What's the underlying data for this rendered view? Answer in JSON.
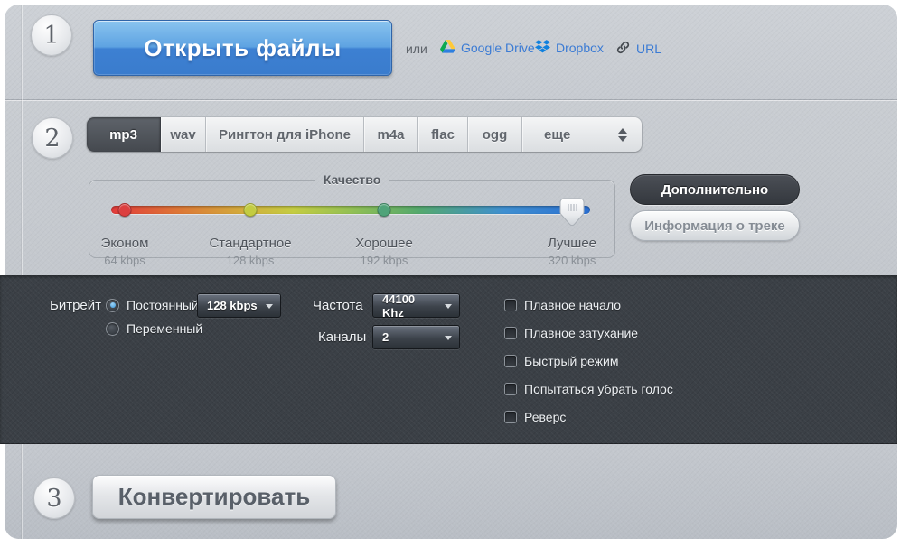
{
  "steps": {
    "one": "1",
    "two": "2",
    "three": "3"
  },
  "step1": {
    "open_button": "Открыть файлы",
    "or_text": "или",
    "links": [
      {
        "label": "Google Drive",
        "icon": "google-drive-icon"
      },
      {
        "label": "Dropbox",
        "icon": "dropbox-icon"
      },
      {
        "label": "URL",
        "icon": "link-icon"
      }
    ]
  },
  "step2": {
    "tabs": [
      {
        "label": "mp3",
        "active": true
      },
      {
        "label": "wav",
        "active": false
      },
      {
        "label": "Рингтон для iPhone",
        "active": false
      },
      {
        "label": "m4a",
        "active": false
      },
      {
        "label": "flac",
        "active": false
      },
      {
        "label": "ogg",
        "active": false
      },
      {
        "label": "еще",
        "active": false,
        "dropdown": true
      }
    ],
    "quality": {
      "legend": "Качество",
      "stops": [
        {
          "label": "Эконом",
          "bitrate": "64 kbps",
          "color": "#dc3f3f"
        },
        {
          "label": "Стандартное",
          "bitrate": "128 kbps",
          "color": "#c3cc41"
        },
        {
          "label": "Хорошее",
          "bitrate": "192 kbps",
          "color": "#4fa379"
        },
        {
          "label": "Лучшее",
          "bitrate": "320 kbps",
          "color": "#2a6fd2"
        }
      ],
      "selected": "320 kbps"
    },
    "advanced_button": "Дополнительно",
    "track_info_button": "Информация о треке"
  },
  "advanced_panel": {
    "bitrate_label": "Битрейт",
    "bitrate_modes": [
      {
        "label": "Постоянный",
        "selected": true
      },
      {
        "label": "Переменный",
        "selected": false
      }
    ],
    "bitrate_value": "128 kbps",
    "frequency_label": "Частота",
    "frequency_value": "44100 Khz",
    "channels_label": "Каналы",
    "channels_value": "2",
    "checkboxes": [
      {
        "label": "Плавное начало",
        "checked": false
      },
      {
        "label": "Плавное затухание",
        "checked": false
      },
      {
        "label": "Быстрый режим",
        "checked": false
      },
      {
        "label": "Попытаться убрать голос",
        "checked": false
      },
      {
        "label": "Реверс",
        "checked": false
      }
    ]
  },
  "step3": {
    "convert_button": "Конвертировать"
  },
  "colors": {
    "accent_blue": "#3d80d2",
    "link_blue": "#3b7bd4",
    "dark_panel": "#3b4046",
    "light_bg": "#c6cad0"
  }
}
